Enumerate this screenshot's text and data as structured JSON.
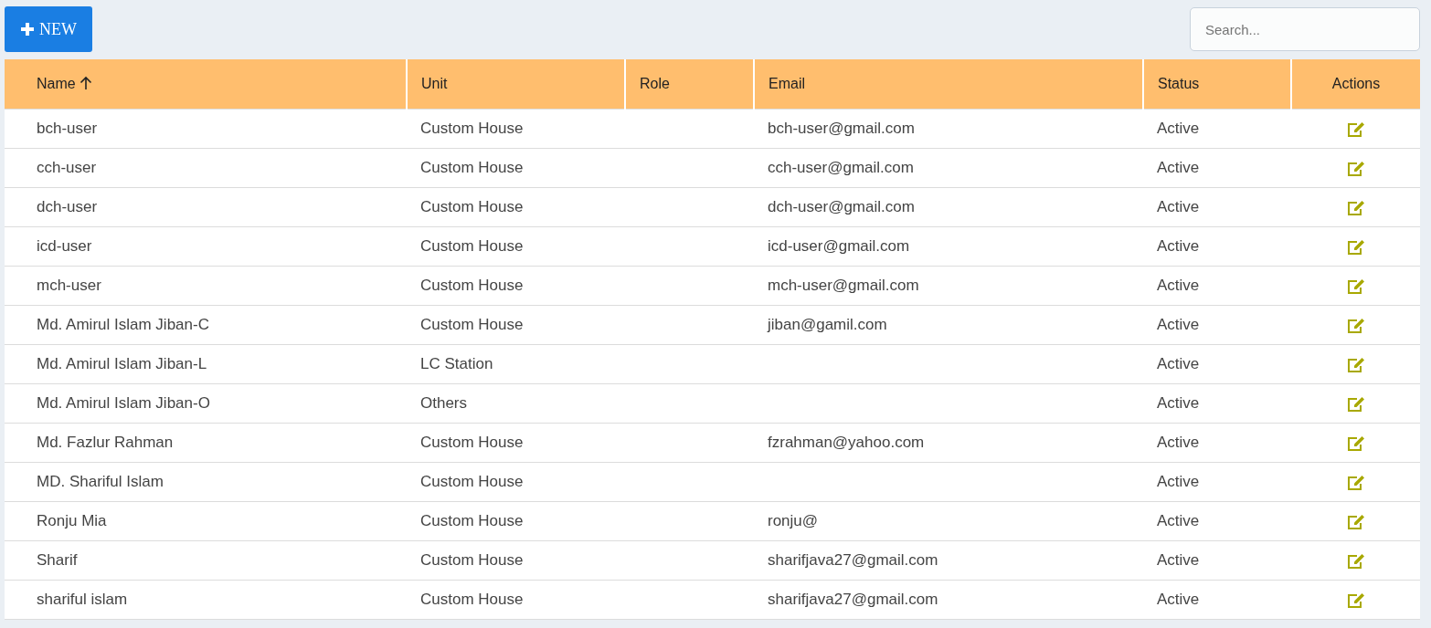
{
  "toolbar": {
    "new_button": {
      "label": "NEW"
    },
    "search": {
      "placeholder": "Search..."
    }
  },
  "table": {
    "columns": [
      {
        "label": "Name",
        "sorted": true
      },
      {
        "label": "Unit",
        "sorted": false
      },
      {
        "label": "Role",
        "sorted": false
      },
      {
        "label": "Email",
        "sorted": false
      },
      {
        "label": "Status",
        "sorted": false
      },
      {
        "label": "Actions",
        "sorted": false
      }
    ],
    "rows": [
      {
        "name": "bch-user",
        "unit": "Custom House",
        "email": "bch-user@gmail.com",
        "status": "Active"
      },
      {
        "name": "cch-user",
        "unit": "Custom House",
        "email": "cch-user@gmail.com",
        "status": "Active"
      },
      {
        "name": "dch-user",
        "unit": "Custom House",
        "email": "dch-user@gmail.com",
        "status": "Active"
      },
      {
        "name": "icd-user",
        "unit": "Custom House",
        "email": "icd-user@gmail.com",
        "status": "Active"
      },
      {
        "name": "mch-user",
        "unit": "Custom House",
        "email": "mch-user@gmail.com",
        "status": "Active"
      },
      {
        "name": "Md. Amirul Islam Jiban-C",
        "unit": "Custom House",
        "email": "jiban@gamil.com",
        "status": "Active"
      },
      {
        "name": "Md. Amirul Islam Jiban-L",
        "unit": "LC Station",
        "status": "Active"
      },
      {
        "name": "Md. Amirul Islam Jiban-O",
        "unit": "Others",
        "status": "Active"
      },
      {
        "name": "Md. Fazlur Rahman",
        "unit": "Custom House",
        "email": "fzrahman@yahoo.com",
        "status": "Active"
      },
      {
        "name": "MD. Shariful Islam",
        "unit": "Custom House",
        "status": "Active"
      },
      {
        "name": "Ronju Mia",
        "unit": "Custom House",
        "email": "ronju@",
        "status": "Active"
      },
      {
        "name": "Sharif",
        "unit": "Custom House",
        "email": "sharifjava27@gmail.com",
        "status": "Active"
      },
      {
        "name": "shariful islam",
        "unit": "Custom House",
        "email": "sharifjava27@gmail.com",
        "status": "Active"
      }
    ]
  }
}
